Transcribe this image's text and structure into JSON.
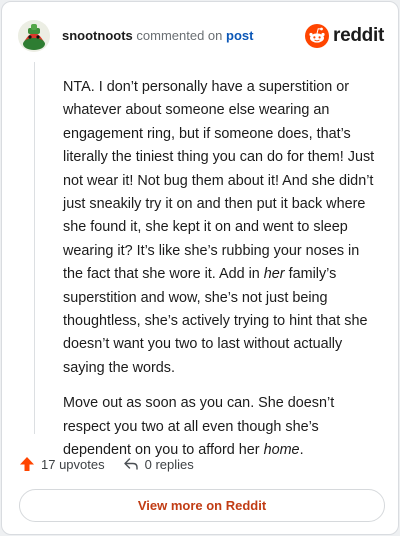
{
  "comment": {
    "username": "snootnoots",
    "action_text": "commented on",
    "post_link": "post",
    "paragraphs": [
      {
        "segments": [
          {
            "text": "NTA. I don’t personally have a superstition or whatever about someone else wearing an engagement ring, but if someone does, that’s literally the tiniest thing you can do for them! Just not wear it! Not bug them about it! And she didn’t just sneakily try it on and then put it back where she found it, she kept it on and went to sleep wearing it? It’s like she’s rubbing your noses in the fact that she wore it. Add in ",
            "italic": false
          },
          {
            "text": "her",
            "italic": true
          },
          {
            "text": " family’s superstition and wow, she’s not just being thoughtless, she’s actively trying to hint that she doesn’t want you two to last without actually saying the words.",
            "italic": false
          }
        ]
      },
      {
        "segments": [
          {
            "text": "Move out as soon as you can. She doesn’t respect you two at all even though she’s dependent on you to afford her ",
            "italic": false
          },
          {
            "text": "home",
            "italic": true
          },
          {
            "text": ".",
            "italic": false
          }
        ]
      }
    ],
    "upvotes_label": "17 upvotes",
    "replies_label": "0 replies"
  },
  "brand": {
    "wordmark": "reddit",
    "icon": "reddit-snoo-icon",
    "color": "#ff4500"
  },
  "actions": {
    "view_more_label": "View more on Reddit"
  },
  "icons": {
    "avatar": "avatar-icon",
    "upvote": "upvote-arrow-icon",
    "reply": "reply-arrow-icon"
  },
  "colors": {
    "link": "#0b57b7",
    "upvote": "#ff4500",
    "button_text": "#c13c14"
  }
}
